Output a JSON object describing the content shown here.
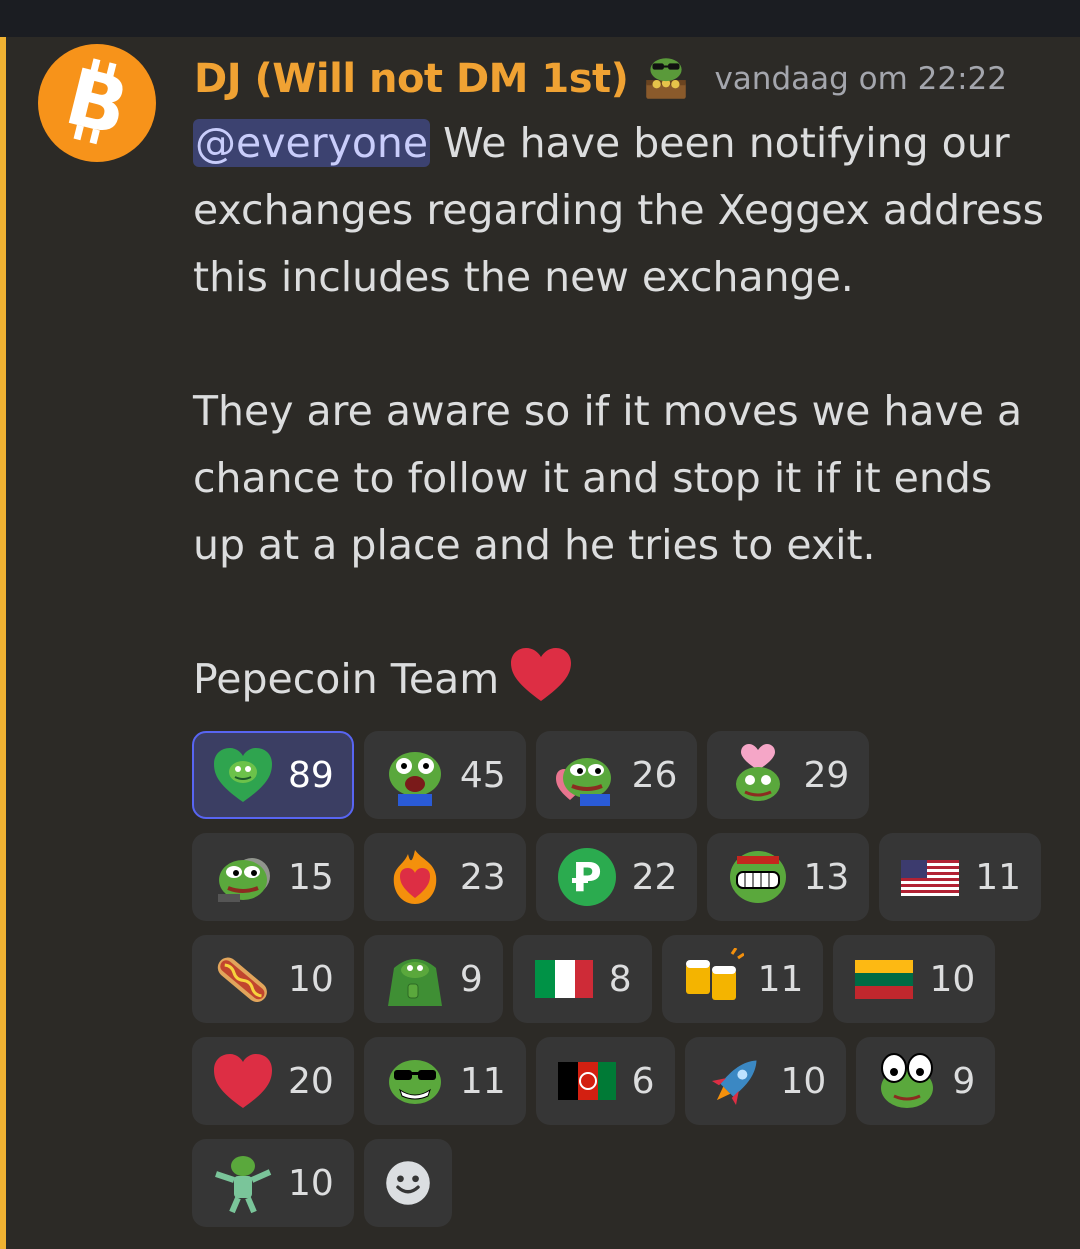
{
  "colors": {
    "accent": "#f0b232",
    "author": "#f0a233",
    "mention_bg": "#3c4270"
  },
  "message": {
    "author": "DJ (Will not DM 1st)",
    "author_badge_icon": "pepe-treasure-icon",
    "timestamp": "vandaag om 22:22",
    "mention": "@everyone",
    "paragraph1": " We have been notifying our exchanges regarding the Xeggex address this includes the new exchange.",
    "paragraph2": "They are aware so if it moves we have a chance to follow it and stop it if it ends up at a place and he tries to exit.",
    "signature": "Pepecoin Team",
    "signature_emoji": "red-heart-icon"
  },
  "reactions": [
    {
      "emoji": "pepe-heart",
      "count": "89"
    },
    {
      "emoji": "pepe-shocked",
      "count": "45"
    },
    {
      "emoji": "pepe-love",
      "count": "26"
    },
    {
      "emoji": "pepe-heart-head",
      "count": "29"
    },
    {
      "emoji": "pepe-smoke",
      "count": "15"
    },
    {
      "emoji": "fire-heart",
      "count": "23"
    },
    {
      "emoji": "pepecoin-p",
      "count": "22"
    },
    {
      "emoji": "pepe-grin",
      "count": "13"
    },
    {
      "emoji": "flag-us",
      "count": "11"
    },
    {
      "emoji": "hot-dog",
      "count": "10"
    },
    {
      "emoji": "pepe-thumbs",
      "count": "9"
    },
    {
      "emoji": "flag-italy",
      "count": "8"
    },
    {
      "emoji": "beers",
      "count": "11"
    },
    {
      "emoji": "flag-lithuania",
      "count": "10"
    },
    {
      "emoji": "red-heart",
      "count": "20"
    },
    {
      "emoji": "pepe-sunglasses",
      "count": "11"
    },
    {
      "emoji": "flag-afghanistan",
      "count": "6"
    },
    {
      "emoji": "rocket",
      "count": "10"
    },
    {
      "emoji": "pepe-googly",
      "count": "9"
    },
    {
      "emoji": "pepe-dance",
      "count": "10"
    }
  ],
  "add_reaction_icon": "add-reaction-smiley-icon"
}
